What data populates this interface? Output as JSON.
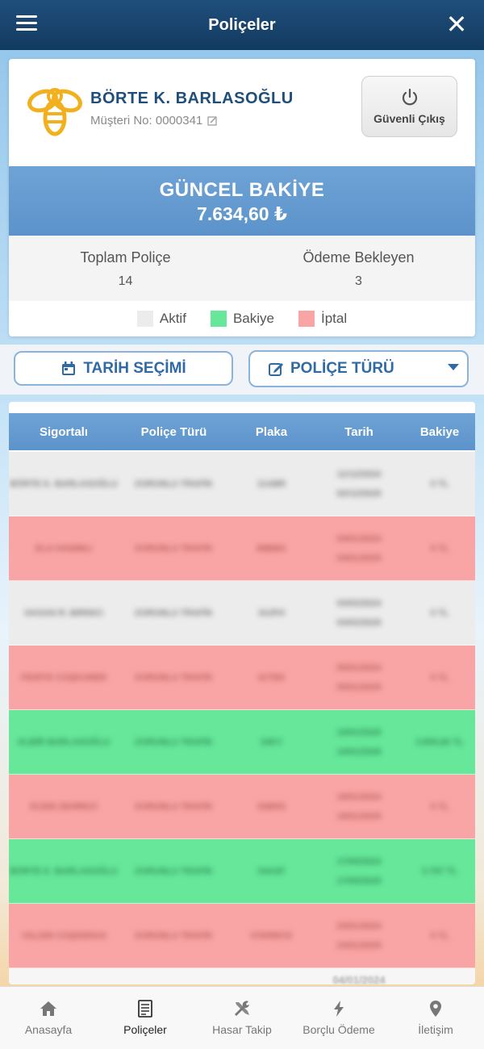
{
  "header": {
    "title": "Poliçeler"
  },
  "profile": {
    "name": "BÖRTE K. BARLASOĞLU",
    "customer_no": "Müşteri No: 0000341",
    "logout_label": "Güvenli Çıkış"
  },
  "balance": {
    "label": "GÜNCEL BAKİYE",
    "value": "7.634,60 ₺"
  },
  "stats": {
    "total_label": "Toplam Poliçe",
    "total_value": "14",
    "pending_label": "Ödeme Bekleyen",
    "pending_value": "3"
  },
  "legend": [
    {
      "label": "Aktif",
      "color": "#ececec"
    },
    {
      "label": "Bakiye",
      "color": "#66e79a"
    },
    {
      "label": "İptal",
      "color": "#f9a5a5"
    }
  ],
  "filters": {
    "date_label": "TARİH SEÇİMİ",
    "type_label": "POLİÇE TÜRÜ"
  },
  "table": {
    "headers": [
      "Sigortalı",
      "Poliçe Türü",
      "Plaka",
      "Tarih",
      "Bakiye"
    ],
    "rows": [
      {
        "status": "aktif",
        "cells": [
          "BÖRTE K. BARLASOĞLU",
          "ZORUNLU TRAFİK",
          "11ABR",
          "11/12/2024 02/12/2025",
          "0 TL"
        ]
      },
      {
        "status": "iptal",
        "cells": [
          "ELA HANIMLI",
          "ZORUNLU TRAFİK",
          "88BBG",
          "04/01/2024 04/01/2025",
          "0 TL"
        ]
      },
      {
        "status": "aktif",
        "cells": [
          "HASAN R. BIRINCI",
          "ZORUNLU TRAFİK",
          "34JFH",
          "03/02/2024 03/02/2025",
          "0 TL"
        ]
      },
      {
        "status": "iptal",
        "cells": [
          "FEHİYE COŞKUNER",
          "ZORUNLU TRAFİK",
          "41TEK",
          "05/01/2024 05/01/2025",
          "0 TL"
        ]
      },
      {
        "status": "bakiye",
        "cells": [
          "ALBİR BARLASOĞLU",
          "ZORUNLU TRAFİK",
          "34KY",
          "10/01/2025 10/01/2026",
          "3.805,60 TL"
        ]
      },
      {
        "status": "iptal",
        "cells": [
          "ECEM ZEHRECİ",
          "ZORUNLU TRAFİK",
          "32BRS",
          "18/01/2024 18/01/2025",
          "0 TL"
        ]
      },
      {
        "status": "bakiye",
        "cells": [
          "BÖRTE K. BARLASOĞLU",
          "ZORUNLU TRAFİK",
          "34ASF",
          "17/05/2024 17/05/2025",
          "3.787 TL"
        ]
      },
      {
        "status": "iptal",
        "cells": [
          "YALGIN COŞKERAS",
          "ZORUNLU TRAFİK",
          "07ERMYE",
          "24/01/2024 24/01/2025",
          "0 TL"
        ]
      }
    ],
    "partial_row_date": "04/01/2024"
  },
  "nav": [
    {
      "label": "Anasayfa",
      "icon": "home-icon"
    },
    {
      "label": "Poliçeler",
      "icon": "document-icon"
    },
    {
      "label": "Hasar Takip",
      "icon": "tools-icon"
    },
    {
      "label": "Borçlu Ödeme",
      "icon": "lightning-icon"
    },
    {
      "label": "İletişim",
      "icon": "location-icon"
    }
  ]
}
